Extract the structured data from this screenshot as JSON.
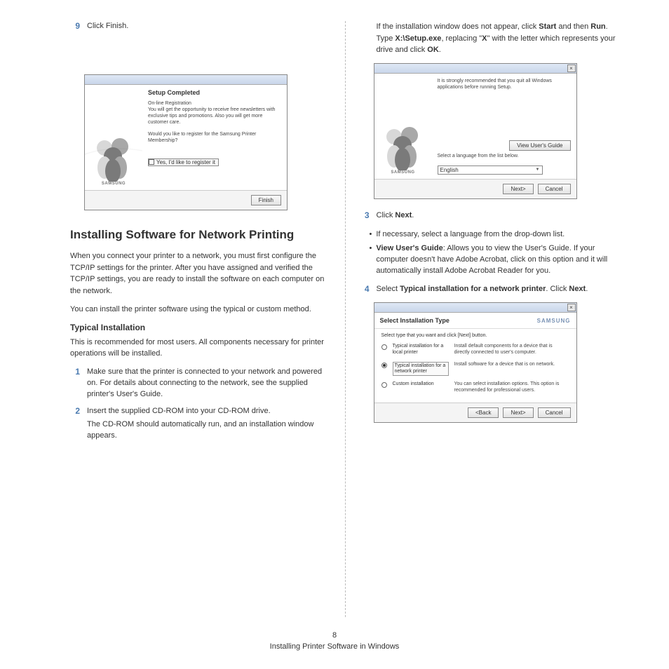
{
  "left": {
    "step9": {
      "num": "9",
      "text": "Click Finish."
    },
    "dlg1": {
      "title": "Setup Completed",
      "regHeading": "On-line Registration",
      "regText": "You will get the opportunity to receive free newsletters with exclusive tips and promotions. Also you will get more customer care.",
      "question": "Would you like to register for the Samsung Printer Membership?",
      "checkbox": "Yes, I'd like to register it",
      "brand": "SAMSUNG",
      "finish": "Finish"
    },
    "sectionTitle": "Installing Software for Network Printing",
    "para1": "When you connect your printer to a network, you must first configure the TCP/IP settings for the printer. After you have assigned and verified the TCP/IP settings, you are ready to install the software on each computer on the network.",
    "para2": "You can install the printer software using the typical or custom method.",
    "subHeading": "Typical Installation",
    "para3": "This is recommended for most users. All components necessary for printer operations will be installed.",
    "step1": {
      "num": "1",
      "text": "Make sure that the printer is connected to your network and powered on. For details about connecting to the network, see the supplied printer's User's Guide."
    },
    "step2": {
      "num": "2",
      "line1": "Insert the supplied CD-ROM into your CD-ROM drive.",
      "line2": "The CD-ROM should automatically run, and an installation window appears."
    }
  },
  "right": {
    "topPara": {
      "t1": "If the installation window does not appear, click ",
      "b1": "Start",
      "t2": " and then ",
      "b2": "Run",
      "t3": ". Type ",
      "b3": "X:\\Setup.exe",
      "t4": ", replacing \"",
      "b4": "X",
      "t5": "\" with the letter which represents your drive and click ",
      "b5": "OK",
      "t6": "."
    },
    "dlg2": {
      "recText": "It is strongly recommended that you quit all Windows applications before running Setup.",
      "viewGuide": "View User's Guide",
      "langLabel": "Select a language from the list below.",
      "langValue": "English",
      "brand": "SAMSUNG",
      "next": "Next>",
      "cancel": "Cancel"
    },
    "step3": {
      "num": "3",
      "line": {
        "t1": "Click ",
        "b1": "Next",
        "t2": "."
      },
      "bullet1": "If necessary, select a language from the drop-down list.",
      "bullet2": {
        "b1": "View User's Guide",
        "t1": ": Allows you to view the User's Guide. If your computer doesn't have Adobe Acrobat, click on this option and it will automatically install Adobe Acrobat Reader for you."
      }
    },
    "step4": {
      "num": "4",
      "t1": "Select ",
      "b1": "Typical installation for a network printer",
      "t2": ". Click ",
      "b2": "Next",
      "t3": "."
    },
    "dlg3": {
      "heading": "Select Installation Type",
      "brand": "SAMSUNG",
      "instr": "Select type that you want and click [Next] button.",
      "opt1": {
        "label": "Typical installation for a local printer",
        "desc": "Install default components for a device that is directly connected to user's computer."
      },
      "opt2": {
        "label": "Typical installation for a network printer",
        "desc": "Install software for a device that is on network."
      },
      "opt3": {
        "label": "Custom installation",
        "desc": "You can select installation options. This option is recommended for professional users."
      },
      "back": "<Back",
      "next": "Next>",
      "cancel": "Cancel"
    }
  },
  "footer": {
    "pageNum": "8",
    "pageTitle": "Installing Printer Software in Windows"
  }
}
